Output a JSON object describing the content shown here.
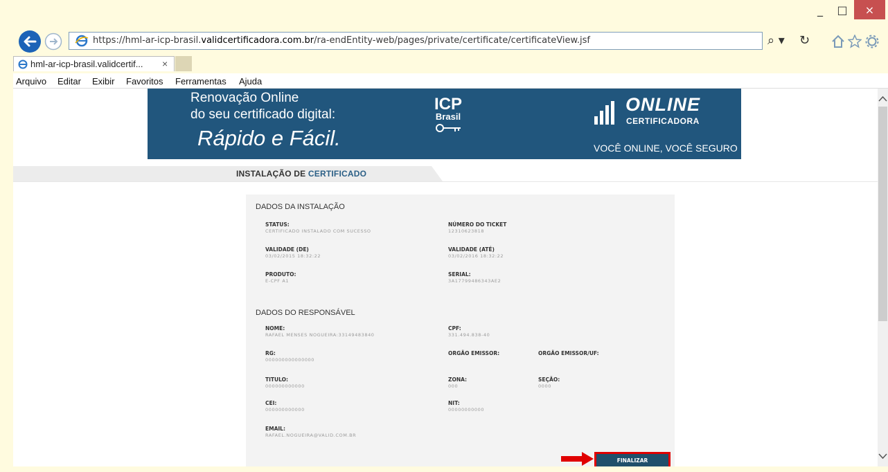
{
  "browser": {
    "url_prefix": "https://hml-ar-icp-brasil.",
    "url_domain": "validcertificadora.com.br",
    "url_path": "/ra-endEntity-web/pages/private/certificate/certificateView.jsf",
    "tab_title": "hml-ar-icp-brasil.validcertif...",
    "tab_close": "×",
    "window_buttons": {
      "minimize": "_",
      "maximize": "□",
      "close": "×"
    },
    "search_glyph": "⌕ ▾",
    "refresh_glyph": "↻"
  },
  "menubar": [
    "Arquivo",
    "Editar",
    "Exibir",
    "Favoritos",
    "Ferramentas",
    "Ajuda"
  ],
  "banner": {
    "line1": "Renovação Online",
    "line2": "do seu certificado digital:",
    "line3": "Rápido e Fácil.",
    "icp_top": "ICP",
    "icp_bottom": "Brasil",
    "brand_name": "ONLINE",
    "brand_sub": "CERTIFICADORA",
    "slogan": "VOCÊ ONLINE, VOCÊ SEGURO"
  },
  "section": {
    "title_part1": "INSTALAÇÃO DE ",
    "title_part2": "CERTIFICADO"
  },
  "installation": {
    "heading": "DADOS DA INSTALAÇÃO",
    "status_label": "STATUS:",
    "status_value": "CERTIFICADO INSTALADO COM SUCESSO",
    "ticket_label": "NÚMERO DO TICKET",
    "ticket_value": "12310623818",
    "validity_from_label": "VALIDADE (DE)",
    "validity_from_value": "03/02/2015 18:32:22",
    "validity_to_label": "VALIDADE (ATÉ)",
    "validity_to_value": "03/02/2016 18:32:22",
    "product_label": "PRODUTO:",
    "product_value": "E-CPF A1",
    "serial_label": "SERIAL:",
    "serial_value": "3A17799486343AE2"
  },
  "responsible": {
    "heading": "DADOS DO RESPONSÁVEL",
    "name_label": "NOME:",
    "name_value": "RAFAEL MENSES NOGUEIRA:33149483840",
    "cpf_label": "CPF:",
    "cpf_value": "331.494.838-40",
    "rg_label": "RG:",
    "rg_value": "000000000000000",
    "issuer_label": "ORGÃO EMISSOR:",
    "issuer_uf_label": "ORGÃO EMISSOR/UF:",
    "title_label": "TITULO:",
    "title_value": "000000000000",
    "zone_label": "ZONA:",
    "zone_value": "000",
    "section_label": "SEÇÃO:",
    "section_value": "0000",
    "cei_label": "CEI:",
    "cei_value": "000000000000",
    "nit_label": "NIT:",
    "nit_value": "00000000000",
    "email_label": "EMAIL:",
    "email_value": "RAFAEL.NOGUEIRA@VALID.COM.BR"
  },
  "actions": {
    "finalize": "FINALIZAR"
  },
  "colors": {
    "banner": "#21567d",
    "button": "#1f4f6b",
    "highlight": "#e00000",
    "chrome": "#fffbdf"
  }
}
